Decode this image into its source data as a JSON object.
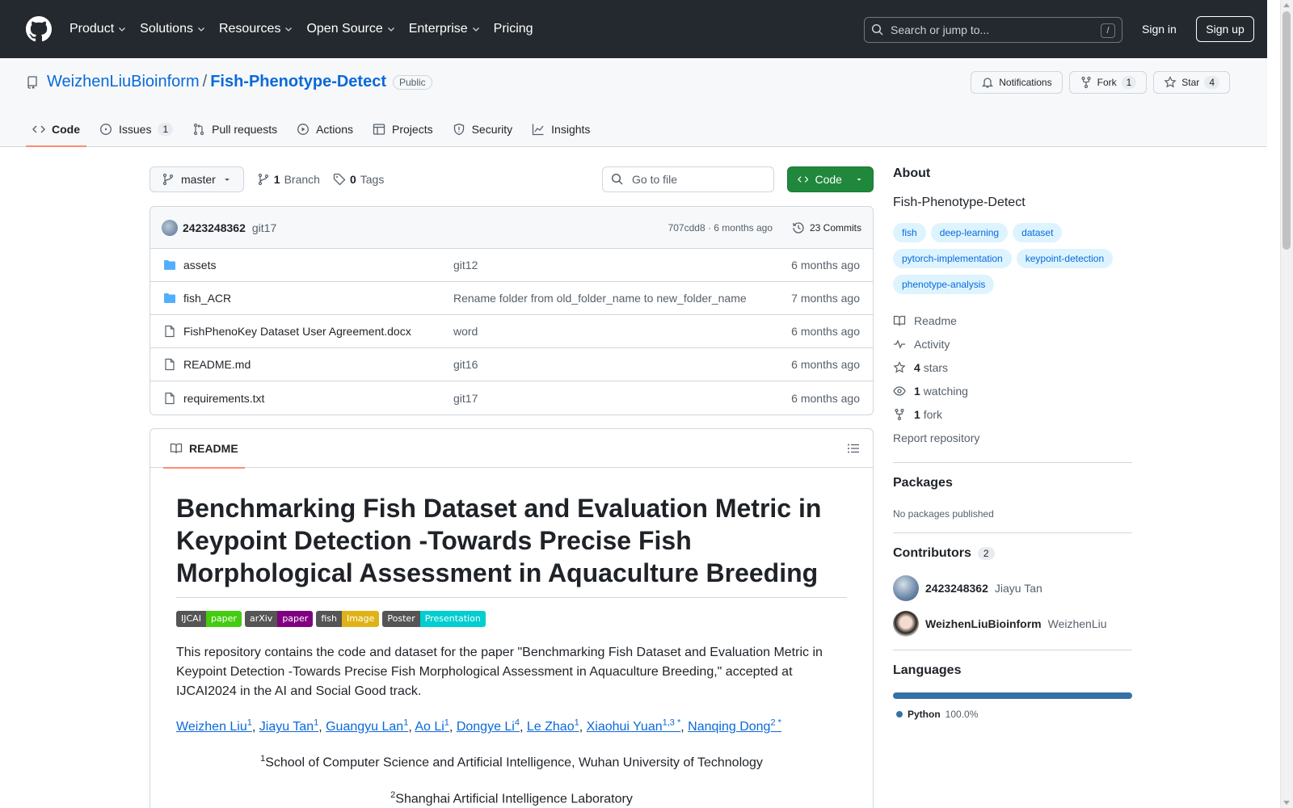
{
  "header": {
    "nav": [
      "Product",
      "Solutions",
      "Resources",
      "Open Source",
      "Enterprise",
      "Pricing"
    ],
    "search_placeholder": "Search or jump to...",
    "search_shortcut": "/",
    "sign_in": "Sign in",
    "sign_up": "Sign up"
  },
  "repo": {
    "owner": "WeizhenLiuBioinform",
    "separator": "/",
    "name": "Fish-Phenotype-Detect",
    "visibility": "Public",
    "notifications_label": "Notifications",
    "fork_label": "Fork",
    "fork_count": "1",
    "star_label": "Star",
    "star_count": "4"
  },
  "tabs": [
    {
      "label": "Code",
      "count": ""
    },
    {
      "label": "Issues",
      "count": "1"
    },
    {
      "label": "Pull requests",
      "count": ""
    },
    {
      "label": "Actions",
      "count": ""
    },
    {
      "label": "Projects",
      "count": ""
    },
    {
      "label": "Security",
      "count": ""
    },
    {
      "label": "Insights",
      "count": ""
    }
  ],
  "toolbar": {
    "branch": "master",
    "branch_count": "1",
    "branch_label": "Branch",
    "tag_count": "0",
    "tag_label": "Tags",
    "goto_placeholder": "Go to file",
    "code_button": "Code"
  },
  "latest_commit": {
    "author": "2423248362",
    "message": "git17",
    "sha_time": "707cdd8 · 6 months ago",
    "commits": "23 Commits"
  },
  "files": [
    {
      "type": "dir",
      "name": "assets",
      "message": "git12",
      "date": "6 months ago"
    },
    {
      "type": "dir",
      "name": "fish_ACR",
      "message": "Rename folder from old_folder_name to new_folder_name",
      "date": "7 months ago"
    },
    {
      "type": "file",
      "name": "FishPhenoKey Dataset User Agreement.docx",
      "message": "word",
      "date": "6 months ago"
    },
    {
      "type": "file",
      "name": "README.md",
      "message": "git16",
      "date": "6 months ago"
    },
    {
      "type": "file",
      "name": "requirements.txt",
      "message": "git17",
      "date": "6 months ago"
    }
  ],
  "readme": {
    "tab_label": "README",
    "title": "Benchmarking Fish Dataset and Evaluation Metric in Keypoint Detection -Towards Precise Fish Morphological Assessment in Aquaculture Breeding",
    "badges": [
      {
        "left": "IJCAI",
        "right": "paper",
        "color": "#4c1"
      },
      {
        "left": "arXiv",
        "right": "paper",
        "color": "#800080"
      },
      {
        "left": "fish",
        "right": "Image",
        "color": "#dfb317"
      },
      {
        "left": "Poster",
        "right": "Presentation",
        "color": "#00ced1"
      }
    ],
    "intro": "This repository contains the code and dataset for the paper \"Benchmarking Fish Dataset and Evaluation Metric in Keypoint Detection -Towards Precise Fish Morphological Assessment in Aquaculture Breeding,\" accepted at IJCAI2024 in the AI and Social Good track.",
    "authors": [
      {
        "name": "Weizhen Liu",
        "sup": "1"
      },
      {
        "name": "Jiayu Tan",
        "sup": "1"
      },
      {
        "name": "Guangyu Lan",
        "sup": "1"
      },
      {
        "name": "Ao Li",
        "sup": "1"
      },
      {
        "name": "Dongye Li",
        "sup": "4"
      },
      {
        "name": "Le Zhao",
        "sup": "1"
      },
      {
        "name": "Xiaohui Yuan",
        "sup": "1,3 *"
      },
      {
        "name": "Nanqing Dong",
        "sup": "2 *"
      }
    ],
    "affil1_sup": "1",
    "affil1": "School of Computer Science and Artificial Intelligence, Wuhan University of Technology",
    "affil2_sup": "2",
    "affil2": "Shanghai Artificial Intelligence Laboratory"
  },
  "about": {
    "heading": "About",
    "description": "Fish-Phenotype-Detect",
    "topics": [
      "fish",
      "deep-learning",
      "dataset",
      "pytorch-implementation",
      "keypoint-detection",
      "phenotype-analysis"
    ],
    "readme": "Readme",
    "activity": "Activity",
    "stars_count": "4",
    "stars_label": "stars",
    "watching_count": "1",
    "watching_label": "watching",
    "fork_count": "1",
    "fork_label": "fork",
    "report": "Report repository"
  },
  "packages": {
    "heading": "Packages",
    "empty": "No packages published"
  },
  "contributors": {
    "heading": "Contributors",
    "count": "2",
    "list": [
      {
        "login": "2423248362",
        "name": "Jiayu Tan"
      },
      {
        "login": "WeizhenLiuBioinform",
        "name": "WeizhenLiu"
      }
    ]
  },
  "languages": {
    "heading": "Languages",
    "items": [
      {
        "name": "Python",
        "percent": "100.0%",
        "color": "#3572A5"
      }
    ]
  }
}
